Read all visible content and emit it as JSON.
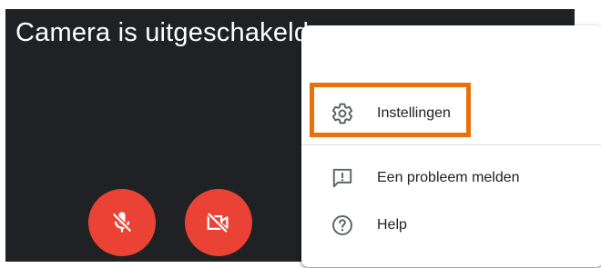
{
  "video": {
    "status_text": "Camera is uitgeschakeld"
  },
  "controls": {
    "microphone": {
      "icon": "mic-off-icon",
      "state": "off"
    },
    "camera": {
      "icon": "videocam-off-icon",
      "state": "off"
    },
    "button_color": "#ea4335"
  },
  "menu": {
    "items": [
      {
        "label": "Instellingen",
        "icon": "gear-icon",
        "highlighted": true
      },
      {
        "label": "Een probleem melden",
        "icon": "feedback-icon"
      },
      {
        "label": "Help",
        "icon": "help-icon"
      }
    ],
    "highlight_color": "#e8710a"
  },
  "colors": {
    "tile_background": "#202124",
    "menu_background": "#ffffff",
    "text": "#202124",
    "icon": "#5f6368"
  }
}
